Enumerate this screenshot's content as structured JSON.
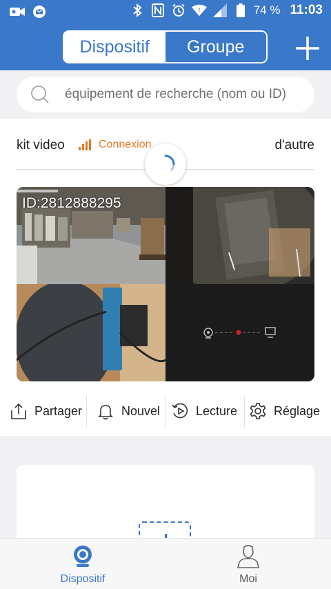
{
  "status_bar": {
    "battery": "74 %",
    "time": "11:03",
    "icons": [
      "camera-icon",
      "mail-icon",
      "bluetooth-icon",
      "nfc-icon",
      "alarm-icon",
      "wifi-icon",
      "cell-signal-icon",
      "battery-icon"
    ]
  },
  "header": {
    "tabs": [
      "Dispositif",
      "Groupe"
    ],
    "active_tab": "Dispositif",
    "add_icon": "plus-icon"
  },
  "search": {
    "placeholder": "équipement de recherche (nom ou ID)",
    "value": ""
  },
  "device": {
    "name": "kit video",
    "status": "Connexion",
    "other_label": "d'autre",
    "camera_id": "ID:2812888295",
    "actions": [
      {
        "label": "Partager",
        "icon": "share-icon"
      },
      {
        "label": "Nouvel",
        "icon": "bell-icon"
      },
      {
        "label": "Lecture",
        "icon": "playback-icon"
      },
      {
        "label": "Réglage",
        "icon": "settings-gear-icon"
      }
    ]
  },
  "bottom_nav": {
    "items": [
      {
        "label": "Dispositif",
        "icon": "camera-device-icon",
        "active": true
      },
      {
        "label": "Moi",
        "icon": "person-icon",
        "active": false
      }
    ]
  },
  "colors": {
    "brand_blue": "#3a78c9",
    "status_orange": "#e07a1f",
    "background": "#f1f1f3"
  }
}
